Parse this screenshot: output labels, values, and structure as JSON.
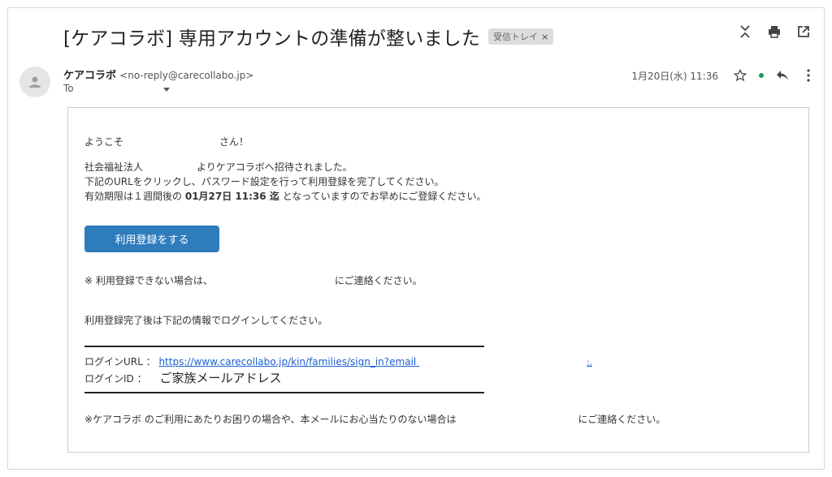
{
  "header": {
    "subject": "[ケアコラボ] 専用アカウントの準備が整いました",
    "label": "受信トレイ",
    "label_close": "×"
  },
  "sender": {
    "name": "ケアコラボ",
    "email": "<no-reply@carecollabo.jp>",
    "to_label": "To",
    "date": "1月20日(水) 11:36"
  },
  "body": {
    "greeting_prefix": "ようこそ",
    "greeting_suffix": "さん！",
    "invite_prefix": "社会福祉法人",
    "invite_suffix": "よりケアコラボへ招待されました。",
    "instruction": "下記のURLをクリックし、パスワード設定を行って利用登録を完了してください。",
    "expiry_prefix": "有効期限は１週間後の",
    "expiry_date": "01月27日 11:36 迄",
    "expiry_suffix": "となっていますのでお早めにご登録ください。",
    "cta_label": "利用登録をする",
    "contact_prefix": "※ 利用登録できない場合は、",
    "contact_suffix": "にご連絡ください。",
    "after_register": "利用登録完了後は下記の情報でログインしてください。",
    "login_url_label": "ログインURL ：",
    "login_url": "https://www.carecollabo.jp/kin/families/sign_in?email",
    "login_id_label": "ログインID ：",
    "login_id_value": "ご家族メールアドレス",
    "footer_prefix": "※ケアコラボ のご利用にあたりお困りの場合や、本メールにお心当たりのない場合は",
    "footer_suffix": "にご連絡ください。"
  }
}
